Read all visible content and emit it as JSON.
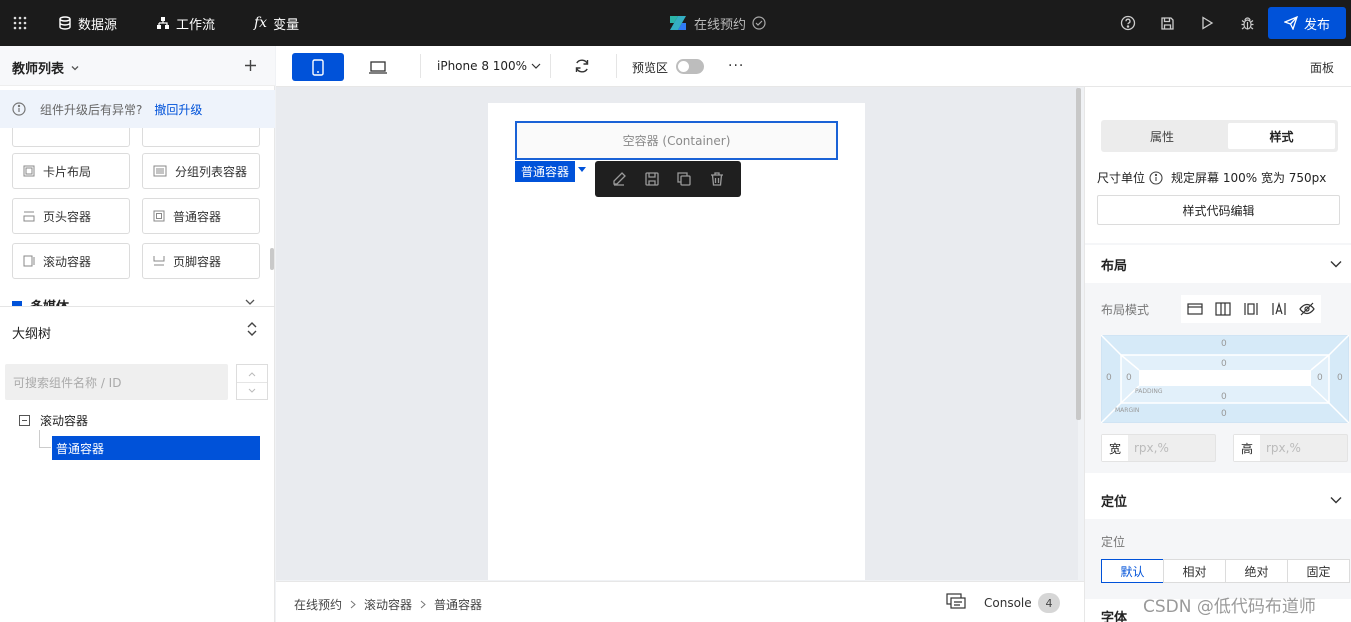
{
  "topbar": {
    "datasource": "数据源",
    "workflow": "工作流",
    "variable": "变量",
    "app_title": "在线预约",
    "publish": "发布"
  },
  "toolbar": {
    "device": "iPhone 8 100%",
    "preview": "预览区",
    "panel": "面板"
  },
  "left": {
    "page_select": "教师列表",
    "notice_text": "组件升级后有异常?",
    "notice_link": "撤回升级",
    "components": [
      "卡片布局",
      "分组列表容器",
      "页头容器",
      "普通容器",
      "滚动容器",
      "页脚容器"
    ],
    "category_partial": "多媒体",
    "outline_title": "大纲树",
    "search_placeholder": "可搜索组件名称 / ID",
    "tree": {
      "root": "滚动容器",
      "child": "普通容器"
    }
  },
  "canvas": {
    "container_placeholder": "空容器 (Container)",
    "selected_tag": "普通容器"
  },
  "bottom": {
    "breadcrumb": [
      "在线预约",
      "滚动容器",
      "普通容器"
    ],
    "console": "Console",
    "console_count": "4",
    "watermark": "CSDN @低代码布道师"
  },
  "right": {
    "tabs": [
      "属性",
      "样式"
    ],
    "unit_label": "尺寸单位",
    "unit_value": "规定屏幕 100% 宽为 750px",
    "code_edit": "样式代码编辑",
    "layout_title": "布局",
    "layout_mode": "布局模式",
    "box": {
      "margin_label": "MARGIN",
      "padding_label": "PADDING",
      "values": "0"
    },
    "width_label": "宽",
    "height_label": "高",
    "size_placeholder": "rpx,%",
    "position_title": "定位",
    "position_label": "定位",
    "position_options": [
      "默认",
      "相对",
      "绝对",
      "固定"
    ],
    "next_partial": "字体"
  },
  "colors": {
    "brand": "#0052d9",
    "topbar": "#1b1b1b"
  }
}
